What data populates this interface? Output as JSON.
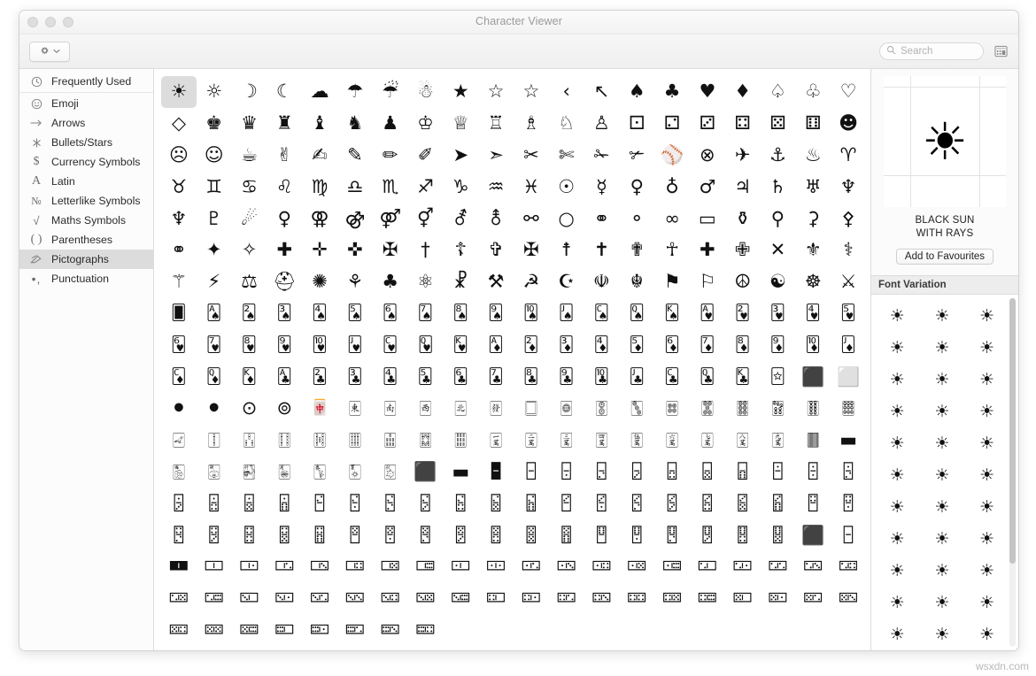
{
  "window": {
    "title": "Character Viewer",
    "traffic_lights": [
      "close-button",
      "minimize-button",
      "zoom-button"
    ]
  },
  "toolbar": {
    "gear_icon": "gear-icon",
    "gear_chevron_icon": "chevron-down-icon",
    "search": {
      "placeholder": "Search",
      "value": "",
      "icon": "search-icon"
    },
    "grid_toggle_icon": "keyboard-grid-icon"
  },
  "sidebar": {
    "items": [
      {
        "label": "Frequently Used",
        "icon": "clock-icon",
        "selected": false
      },
      {
        "label": "Emoji",
        "icon": "smiley-icon",
        "selected": false
      },
      {
        "label": "Arrows",
        "icon": "arrow-right-icon",
        "selected": false
      },
      {
        "label": "Bullets/Stars",
        "icon": "sparkle-icon",
        "selected": false
      },
      {
        "label": "Currency Symbols",
        "icon": "dollar-icon",
        "selected": false
      },
      {
        "label": "Latin",
        "icon": "letter-a-icon",
        "selected": false
      },
      {
        "label": "Letterlike Symbols",
        "icon": "numero-icon",
        "selected": false
      },
      {
        "label": "Maths Symbols",
        "icon": "radical-icon",
        "selected": false
      },
      {
        "label": "Parentheses",
        "icon": "parentheses-icon",
        "selected": false
      },
      {
        "label": "Pictographs",
        "icon": "pictograph-icon",
        "selected": true
      },
      {
        "label": "Punctuation",
        "icon": "punctuation-icon",
        "selected": false
      }
    ]
  },
  "detail": {
    "preview_glyph": "☀",
    "character_name_line1": "BLACK SUN",
    "character_name_line2": "WITH RAYS",
    "favourite_button": "Add to Favourites",
    "font_variation_header": "Font Variation",
    "font_variations": [
      "☀",
      "☀",
      "☀",
      "☀",
      "☀",
      "☀",
      "☀",
      "☀",
      "☀",
      "☀",
      "☀",
      "☀",
      "☀",
      "☀",
      "☀",
      "☀",
      "☀",
      "☀",
      "☀",
      "☀",
      "☀",
      "☀",
      "☀",
      "☀",
      "☀",
      "☀",
      "☀",
      "☀",
      "☀",
      "☀",
      "☀",
      "☀",
      "☀"
    ]
  },
  "grid": {
    "columns": 20,
    "selected_index": 0,
    "characters": [
      "☀",
      "☼",
      "☽",
      "☾",
      "☁",
      "☂",
      "☔",
      "☃",
      "★",
      "☆",
      "☆",
      "‹",
      "↖",
      "♠",
      "♣",
      "♥",
      "♦",
      "♤",
      "♧",
      "♡",
      "◇",
      "♚",
      "♛",
      "♜",
      "♝",
      "♞",
      "♟",
      "♔",
      "♕",
      "♖",
      "♗",
      "♘",
      "♙",
      "⚀",
      "⚁",
      "⚂",
      "⚃",
      "⚄",
      "⚅",
      "☻",
      "☹",
      "☺",
      "☕",
      "✌",
      "✍",
      "✎",
      "✏",
      "✐",
      "➤",
      "➣",
      "✂",
      "✄",
      "✁",
      "✃",
      "⚾",
      "⊗",
      "✈",
      "⚓",
      "♨",
      "♈",
      "♉",
      "♊",
      "♋",
      "♌",
      "♍",
      "♎",
      "♏",
      "♐",
      "♑",
      "♒",
      "♓",
      "☉",
      "☿",
      "♀",
      "♁",
      "♂",
      "♃",
      "♄",
      "♅",
      "♆",
      "♆",
      "♇",
      "☄",
      "♀",
      "⚢",
      "⚣",
      "⚤",
      "⚥",
      "⚦",
      "⚨",
      "⚯",
      "○",
      "⚭",
      "⚬",
      "∞",
      "▭",
      "⚱",
      "⚲",
      "⚳",
      "⚴",
      "⚭",
      "✦",
      "✧",
      "✚",
      "✛",
      "✜",
      "✠",
      "†",
      "☦",
      "✞",
      "✠",
      "☨",
      "✝",
      "✟",
      "☥",
      "✚",
      "✙",
      "✕",
      "⚜",
      "⚕",
      "⚚",
      "⚡",
      "⚖",
      "⛑",
      "✺",
      "⚘",
      "♣",
      "⚛",
      "☧",
      "⚒",
      "☭",
      "☪",
      "☫",
      "☬",
      "⚑",
      "⚐",
      "☮",
      "☯",
      "☸",
      "⚔",
      "🂠",
      "🂡",
      "🂢",
      "🂣",
      "🂤",
      "🂥",
      "🂦",
      "🂧",
      "🂨",
      "🂩",
      "🂪",
      "🂫",
      "🂬",
      "🂭",
      "🂮",
      "🂱",
      "🂲",
      "🂳",
      "🂴",
      "🂵",
      "🂶",
      "🂷",
      "🂸",
      "🂹",
      "🂺",
      "🂻",
      "🂼",
      "🂽",
      "🂾",
      "🃁",
      "🃂",
      "🃃",
      "🃄",
      "🃅",
      "🃆",
      "🃇",
      "🃈",
      "🃉",
      "🃊",
      "🃋",
      "🃌",
      "🃍",
      "🃎",
      "🃑",
      "🃒",
      "🃓",
      "🃔",
      "🃕",
      "🃖",
      "🃗",
      "🃘",
      "🃙",
      "🃚",
      "🃛",
      "🃜",
      "🃝",
      "🃞",
      "🃟",
      "⬛",
      "⬜",
      "⚫",
      "⚫",
      "⊙",
      "⊚",
      "🀄",
      "🀀",
      "🀁",
      "🀂",
      "🀃",
      "🀅",
      "🀆",
      "🀙",
      "🀚",
      "🀛",
      "🀜",
      "🀝",
      "🀞",
      "🀟",
      "🀠",
      "🀡",
      "🀐",
      "🀑",
      "🀒",
      "🀓",
      "🀔",
      "🀕",
      "🀖",
      "🀗",
      "🀘",
      "🀇",
      "🀈",
      "🀉",
      "🀊",
      "🀋",
      "🀌",
      "🀍",
      "🀎",
      "🀏",
      "🀫",
      "▬",
      "🀢",
      "🀣",
      "🀤",
      "🀥",
      "🀦",
      "🀧",
      "🀨",
      "⬛",
      "▬",
      "🁢",
      "🁣",
      "🁤",
      "🁥",
      "🁦",
      "🁧",
      "🁨",
      "🁩",
      "🁪",
      "🁫",
      "🁬",
      "🁭",
      "🁮",
      "🁯",
      "🁰",
      "🁱",
      "🁲",
      "🁳",
      "🁴",
      "🁵",
      "🁶",
      "🁷",
      "🁸",
      "🁹",
      "🁺",
      "🁻",
      "🁼",
      "🁽",
      "🁾",
      "🁿",
      "🂀",
      "🂁",
      "🂂",
      "🂃",
      "🂄",
      "🂅",
      "🂆",
      "🂇",
      "🂈",
      "🂉",
      "🂊",
      "🂋",
      "🂌",
      "🂍",
      "🂎",
      "🂏",
      "🂐",
      "🂑",
      "🂒",
      "⬛",
      "🁣",
      "🀰",
      "🀱",
      "🀲",
      "🀳",
      "🀴",
      "🀵",
      "🀶",
      "🀷",
      "🀸",
      "🀹",
      "🀺",
      "🀻",
      "🀼",
      "🀽",
      "🀾",
      "🀿",
      "🁀",
      "🁁",
      "🁂",
      "🁃",
      "🁄",
      "🁅",
      "🁆",
      "🁇",
      "🁈",
      "🁉",
      "🁊",
      "🁋",
      "🁌",
      "🁍",
      "🁎",
      "🁏",
      "🁐",
      "🁑",
      "🁒",
      "🁓",
      "🁔",
      "🁕",
      "🁖",
      "🁗",
      "🁘",
      "🁙",
      "🁚",
      "🁛",
      "🁜",
      "🁝",
      "🁞",
      "🁟"
    ]
  },
  "watermark": "wsxdn.com"
}
